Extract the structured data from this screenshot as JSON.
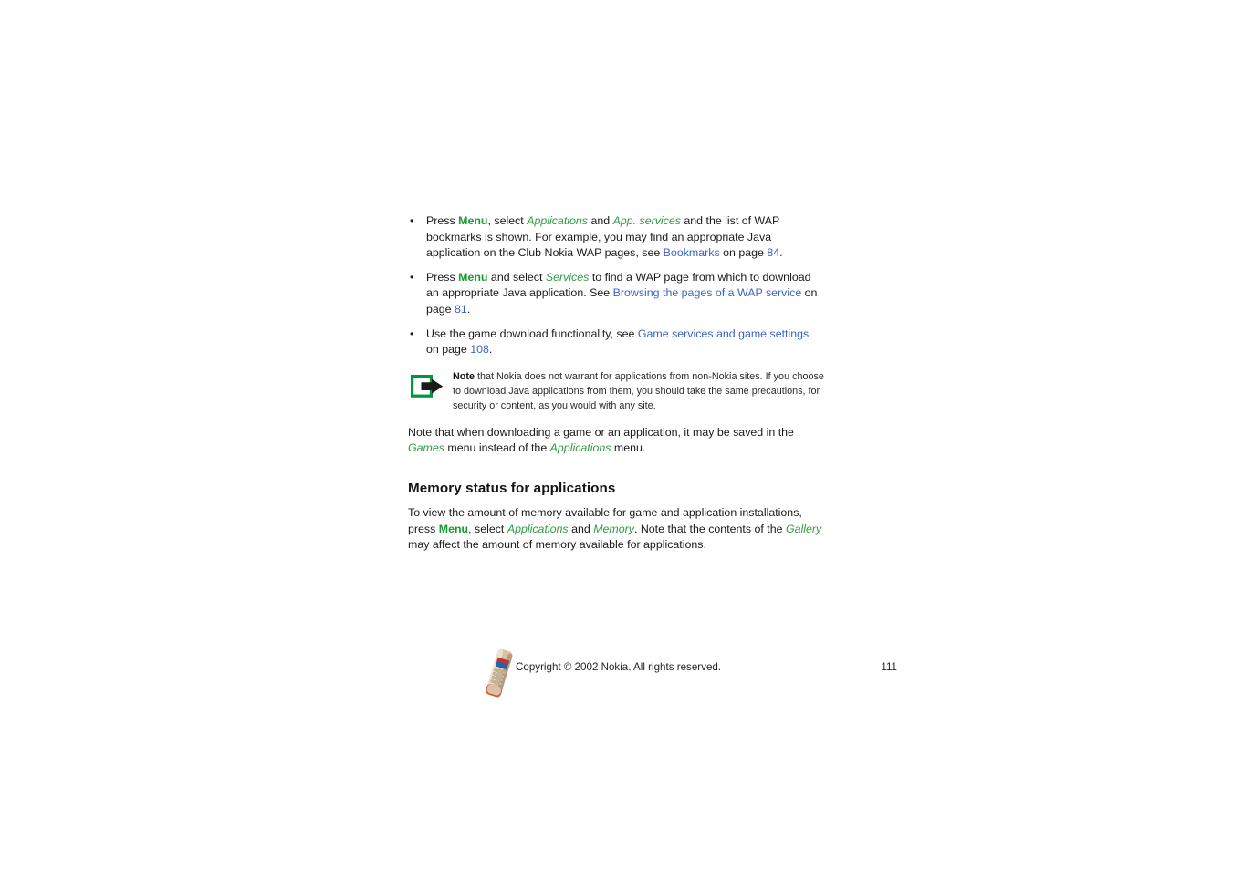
{
  "document": {
    "page_number": "111",
    "colors": {
      "term_green": "#2f9c41",
      "key_green": "#1d9b34",
      "crossref_blue": "#3b63c4",
      "body_text": "#1a1a1a",
      "background": "#ffffff",
      "note_icon_green": "#00953f",
      "note_icon_arrow": "#1a1a1a"
    }
  },
  "bullets": [
    {
      "marker": "•",
      "segments": [
        {
          "type": "text",
          "text": "Press "
        },
        {
          "type": "key",
          "text": "Menu"
        },
        {
          "type": "text",
          "text": ", select "
        },
        {
          "type": "term",
          "text": "Applications"
        },
        {
          "type": "text",
          "text": " and "
        },
        {
          "type": "term",
          "text": "App. services"
        },
        {
          "type": "text",
          "text": " and the list of WAP bookmarks is shown. For example, you may find an appropriate Java application on the Club Nokia WAP pages, see "
        },
        {
          "type": "xref",
          "text": "Bookmarks"
        },
        {
          "type": "text",
          "text": " on page "
        },
        {
          "type": "pagenum",
          "text": "84"
        },
        {
          "type": "text",
          "text": "."
        }
      ]
    },
    {
      "marker": "•",
      "segments": [
        {
          "type": "text",
          "text": "Press "
        },
        {
          "type": "key",
          "text": "Menu"
        },
        {
          "type": "text",
          "text": " and select "
        },
        {
          "type": "term",
          "text": "Services"
        },
        {
          "type": "text",
          "text": " to find a WAP page from which to download an appropriate Java application. See "
        },
        {
          "type": "xref",
          "text": "Browsing the pages of a WAP service"
        },
        {
          "type": "text",
          "text": " on page "
        },
        {
          "type": "pagenum",
          "text": "81"
        },
        {
          "type": "text",
          "text": "."
        }
      ]
    },
    {
      "marker": "•",
      "segments": [
        {
          "type": "text",
          "text": "Use the game download functionality, see "
        },
        {
          "type": "xref",
          "text": "Game services and game settings"
        },
        {
          "type": "text",
          "text": " on page "
        },
        {
          "type": "pagenum",
          "text": "108"
        },
        {
          "type": "text",
          "text": "."
        }
      ]
    }
  ],
  "note": {
    "icon_name": "note-arrow-icon",
    "label": "Note",
    "body": " that Nokia does not warrant for applications from non-Nokia sites. If you choose to download Java applications from them, you should take the same precautions, for security or content, as you would with any site."
  },
  "paragraph_after_note": {
    "segments": [
      {
        "type": "text",
        "text": "Note that when downloading a game or an application, it may be saved in the "
      },
      {
        "type": "term",
        "text": "Games"
      },
      {
        "type": "text",
        "text": " menu instead of the "
      },
      {
        "type": "term",
        "text": "Applications"
      },
      {
        "type": "text",
        "text": " menu."
      }
    ]
  },
  "section": {
    "heading": "Memory status for applications",
    "paragraph": {
      "segments": [
        {
          "type": "text",
          "text": "To view the amount of memory available for game and application installations, press "
        },
        {
          "type": "key",
          "text": "Menu"
        },
        {
          "type": "text",
          "text": ", select "
        },
        {
          "type": "term",
          "text": "Applications"
        },
        {
          "type": "text",
          "text": " and "
        },
        {
          "type": "term",
          "text": "Memory"
        },
        {
          "type": "text",
          "text": ". Note that the contents of the "
        },
        {
          "type": "term",
          "text": "Gallery"
        },
        {
          "type": "text",
          "text": " may affect the amount of memory available for applications."
        }
      ]
    }
  },
  "footer": {
    "phone_image_name": "nokia-phone-thumbnail",
    "copyright": "Copyright © 2002 Nokia. All rights reserved.",
    "page_number": "111"
  }
}
